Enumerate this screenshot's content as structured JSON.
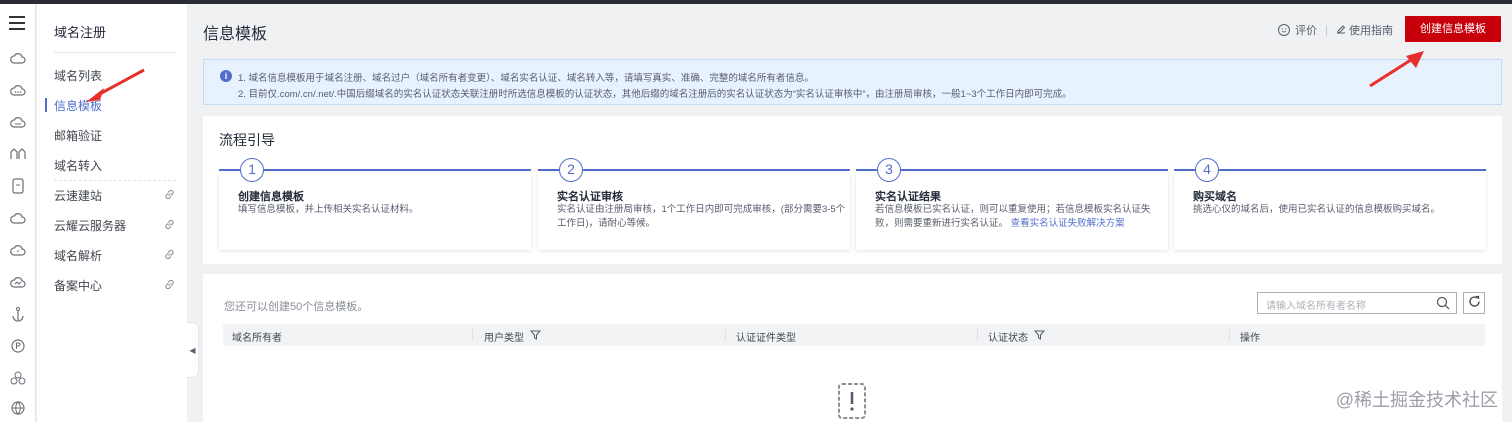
{
  "sidebar": {
    "title": "域名注册",
    "items": [
      {
        "label": "域名列表",
        "external": false
      },
      {
        "label": "信息模板",
        "external": false,
        "active": true
      },
      {
        "label": "邮箱验证",
        "external": false
      },
      {
        "label": "域名转入",
        "external": false
      },
      {
        "label": "云速建站",
        "external": true
      },
      {
        "label": "云耀云服务器",
        "external": true
      },
      {
        "label": "域名解析",
        "external": true
      },
      {
        "label": "备案中心",
        "external": true
      }
    ]
  },
  "header": {
    "title": "信息模板",
    "rate_label": "评价",
    "guide_label": "使用指南",
    "create_button": "创建信息模板"
  },
  "notice": {
    "line1": "1. 域名信息模板用于域名注册、域名过户（域名所有者变更）、域名实名认证、域名转入等，请填写真实、准确、完整的域名所有者信息。",
    "line2": "2. 目前仅.com/.cn/.net/.中国后缀域名的实名认证状态关联注册时所选信息模板的认证状态，其他后缀的域名注册后的实名认证状态为“实名认证审核中”，由注册局审核，一般1~3个工作日内即可完成。"
  },
  "flow": {
    "title": "流程引导",
    "steps": [
      {
        "num": "1",
        "title": "创建信息模板",
        "desc": "填写信息模板，并上传相关实名认证材料。",
        "link": ""
      },
      {
        "num": "2",
        "title": "实名认证审核",
        "desc": "实名认证由注册局审核，1个工作日内即可完成审核，(部分需要3-5个工作日)，请耐心等候。",
        "link": ""
      },
      {
        "num": "3",
        "title": "实名认证结果",
        "desc": "若信息模板已实名认证，则可以重复使用；若信息模板实名认证失败，则需要重新进行实名认证。",
        "link": "查看实名认证失败解决方案"
      },
      {
        "num": "4",
        "title": "购买域名",
        "desc": "挑选心仪的域名后，使用已实名认证的信息模板购买域名。",
        "link": ""
      }
    ]
  },
  "list": {
    "hint": "您还可以创建50个信息模板。",
    "search_placeholder": "请输入域名所有者名称",
    "columns": [
      {
        "label": "域名所有者",
        "filter": false
      },
      {
        "label": "用户类型",
        "filter": true
      },
      {
        "label": "认证证件类型",
        "filter": false
      },
      {
        "label": "认证状态",
        "filter": true
      },
      {
        "label": "操作",
        "filter": false
      }
    ]
  },
  "watermark": "@稀土掘金技术社区",
  "colors": {
    "accent": "#526ecc",
    "brand_red": "#c7000b",
    "annotation_arrow": "#e8302a"
  }
}
